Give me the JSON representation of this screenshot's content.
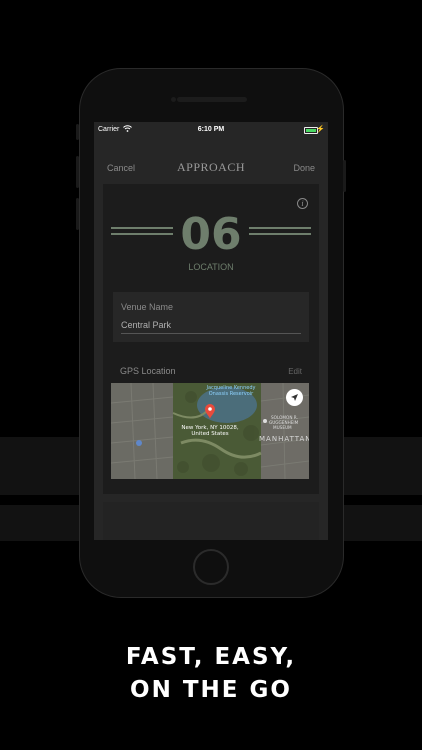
{
  "status_bar": {
    "carrier": "Carrier",
    "time": "6:10 PM",
    "battery_level": 1.0
  },
  "nav": {
    "cancel": "Cancel",
    "title": "APPROACH",
    "done": "Done"
  },
  "step": {
    "number": "06",
    "label": "LOCATION",
    "info_icon": "i"
  },
  "venue": {
    "label": "Venue Name",
    "value": "Central Park"
  },
  "gps": {
    "label": "GPS Location",
    "edit": "Edit"
  },
  "map": {
    "pin_label_line1": "New York, NY 10028,",
    "pin_label_line2": "United States",
    "poi1_line1": "Jacqueline Kennedy",
    "poi1_line2": "Onassis Reservoir",
    "poi2_line1": "SOLOMON R.",
    "poi2_line2": "GUGGENHEIM",
    "poi2_line3": "MUSEUM",
    "district": "MANHATTAN"
  },
  "slogan": {
    "line1": "FAST, EASY,",
    "line2": "ON THE GO"
  },
  "colors": {
    "accent": "#6e7e6c",
    "background": "#000000",
    "screen": "#262626",
    "card": "#1c1c1c",
    "map_pin": "#e94b3c"
  }
}
